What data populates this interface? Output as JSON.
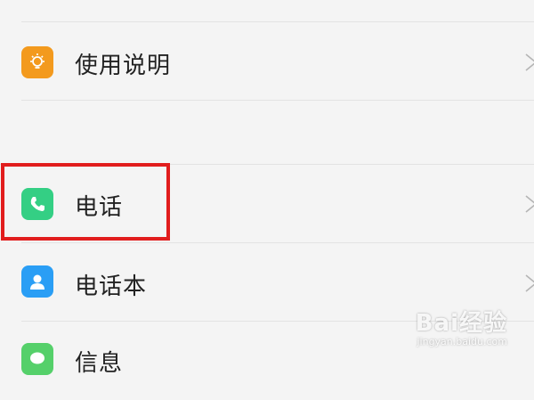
{
  "settings_list": {
    "items": [
      {
        "label": "使用说明",
        "icon": "lightbulb-icon",
        "icon_color": "#f39a1e"
      },
      {
        "label": "电话",
        "icon": "phone-icon",
        "icon_color": "#34cf84"
      },
      {
        "label": "电话本",
        "icon": "contact-icon",
        "icon_color": "#2a9ef5"
      },
      {
        "label": "信息",
        "icon": "message-icon",
        "icon_color": "#55d06a"
      }
    ]
  },
  "watermark": {
    "main": "Bai经验",
    "sub": "jingyan.baidu.com"
  },
  "highlight_color": "#e11d1d"
}
